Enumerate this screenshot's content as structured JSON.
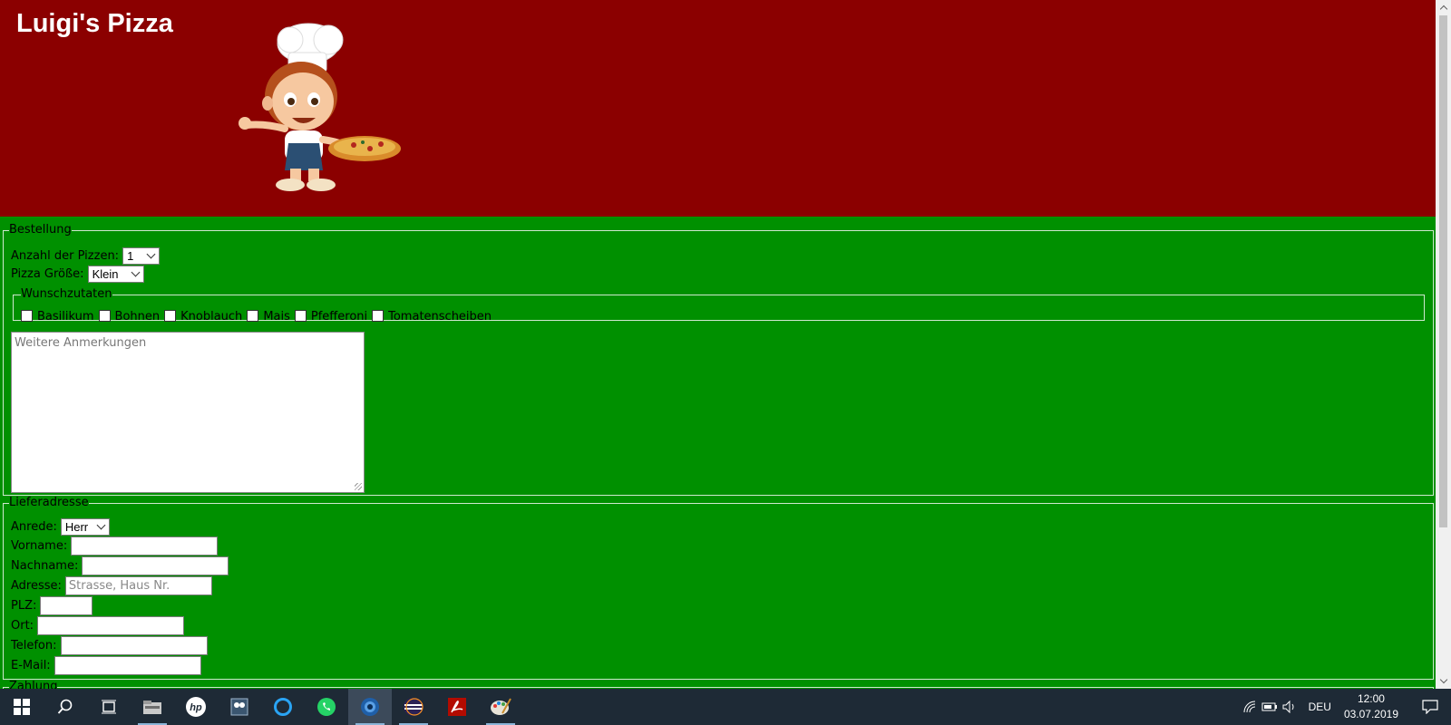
{
  "header": {
    "title": "Luigi's Pizza"
  },
  "order": {
    "legend": "Bestellung",
    "quantity_label": "Anzahl der Pizzen:",
    "quantity_value": "1",
    "size_label": "Pizza Größe:",
    "size_value": "Klein",
    "toppings_legend": "Wunschzutaten",
    "toppings": [
      "Basilikum",
      "Bohnen",
      "Knoblauch",
      "Mais",
      "Pfefferoni",
      "Tomatenscheiben"
    ],
    "notes_placeholder": "Weitere Anmerkungen"
  },
  "address": {
    "legend": "Lieferadresse",
    "salutation_label": "Anrede:",
    "salutation_value": "Herr",
    "first_name_label": "Vorname:",
    "last_name_label": "Nachname:",
    "street_label": "Adresse:",
    "street_placeholder": "Strasse, Haus Nr.",
    "zip_label": "PLZ:",
    "city_label": "Ort:",
    "phone_label": "Telefon:",
    "email_label": "E-Mail:"
  },
  "payment": {
    "legend": "Zahlung"
  },
  "taskbar": {
    "apps": [
      "start-icon",
      "search-icon",
      "task-view-icon",
      "file-explorer-icon",
      "hp-icon",
      "snipping-tool-icon",
      "cortana-icon",
      "whatsapp-icon",
      "browser-icon",
      "eclipse-icon",
      "acrobat-icon",
      "paint-icon"
    ],
    "language": "DEU",
    "time": "12:00",
    "date": "03.07.2019"
  },
  "colors": {
    "header_bg": "#8b0000",
    "body_bg": "#009000",
    "taskbar_bg": "#1e2a36"
  }
}
